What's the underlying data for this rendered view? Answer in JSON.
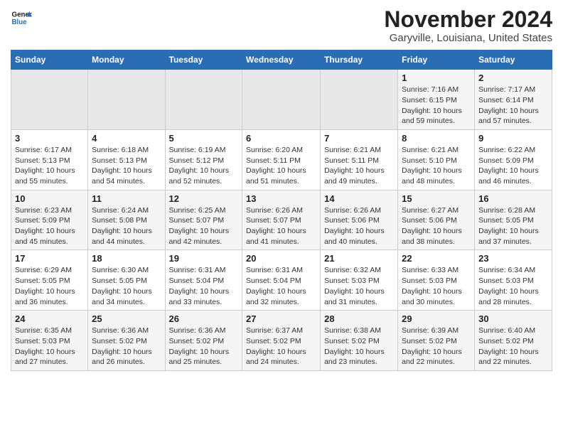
{
  "header": {
    "logo_line1": "General",
    "logo_line2": "Blue",
    "month": "November 2024",
    "location": "Garyville, Louisiana, United States"
  },
  "days_of_week": [
    "Sunday",
    "Monday",
    "Tuesday",
    "Wednesday",
    "Thursday",
    "Friday",
    "Saturday"
  ],
  "weeks": [
    [
      {
        "day": "",
        "info": ""
      },
      {
        "day": "",
        "info": ""
      },
      {
        "day": "",
        "info": ""
      },
      {
        "day": "",
        "info": ""
      },
      {
        "day": "",
        "info": ""
      },
      {
        "day": "1",
        "info": "Sunrise: 7:16 AM\nSunset: 6:15 PM\nDaylight: 10 hours and 59 minutes."
      },
      {
        "day": "2",
        "info": "Sunrise: 7:17 AM\nSunset: 6:14 PM\nDaylight: 10 hours and 57 minutes."
      }
    ],
    [
      {
        "day": "3",
        "info": "Sunrise: 6:17 AM\nSunset: 5:13 PM\nDaylight: 10 hours and 55 minutes."
      },
      {
        "day": "4",
        "info": "Sunrise: 6:18 AM\nSunset: 5:13 PM\nDaylight: 10 hours and 54 minutes."
      },
      {
        "day": "5",
        "info": "Sunrise: 6:19 AM\nSunset: 5:12 PM\nDaylight: 10 hours and 52 minutes."
      },
      {
        "day": "6",
        "info": "Sunrise: 6:20 AM\nSunset: 5:11 PM\nDaylight: 10 hours and 51 minutes."
      },
      {
        "day": "7",
        "info": "Sunrise: 6:21 AM\nSunset: 5:11 PM\nDaylight: 10 hours and 49 minutes."
      },
      {
        "day": "8",
        "info": "Sunrise: 6:21 AM\nSunset: 5:10 PM\nDaylight: 10 hours and 48 minutes."
      },
      {
        "day": "9",
        "info": "Sunrise: 6:22 AM\nSunset: 5:09 PM\nDaylight: 10 hours and 46 minutes."
      }
    ],
    [
      {
        "day": "10",
        "info": "Sunrise: 6:23 AM\nSunset: 5:09 PM\nDaylight: 10 hours and 45 minutes."
      },
      {
        "day": "11",
        "info": "Sunrise: 6:24 AM\nSunset: 5:08 PM\nDaylight: 10 hours and 44 minutes."
      },
      {
        "day": "12",
        "info": "Sunrise: 6:25 AM\nSunset: 5:07 PM\nDaylight: 10 hours and 42 minutes."
      },
      {
        "day": "13",
        "info": "Sunrise: 6:26 AM\nSunset: 5:07 PM\nDaylight: 10 hours and 41 minutes."
      },
      {
        "day": "14",
        "info": "Sunrise: 6:26 AM\nSunset: 5:06 PM\nDaylight: 10 hours and 40 minutes."
      },
      {
        "day": "15",
        "info": "Sunrise: 6:27 AM\nSunset: 5:06 PM\nDaylight: 10 hours and 38 minutes."
      },
      {
        "day": "16",
        "info": "Sunrise: 6:28 AM\nSunset: 5:05 PM\nDaylight: 10 hours and 37 minutes."
      }
    ],
    [
      {
        "day": "17",
        "info": "Sunrise: 6:29 AM\nSunset: 5:05 PM\nDaylight: 10 hours and 36 minutes."
      },
      {
        "day": "18",
        "info": "Sunrise: 6:30 AM\nSunset: 5:05 PM\nDaylight: 10 hours and 34 minutes."
      },
      {
        "day": "19",
        "info": "Sunrise: 6:31 AM\nSunset: 5:04 PM\nDaylight: 10 hours and 33 minutes."
      },
      {
        "day": "20",
        "info": "Sunrise: 6:31 AM\nSunset: 5:04 PM\nDaylight: 10 hours and 32 minutes."
      },
      {
        "day": "21",
        "info": "Sunrise: 6:32 AM\nSunset: 5:03 PM\nDaylight: 10 hours and 31 minutes."
      },
      {
        "day": "22",
        "info": "Sunrise: 6:33 AM\nSunset: 5:03 PM\nDaylight: 10 hours and 30 minutes."
      },
      {
        "day": "23",
        "info": "Sunrise: 6:34 AM\nSunset: 5:03 PM\nDaylight: 10 hours and 28 minutes."
      }
    ],
    [
      {
        "day": "24",
        "info": "Sunrise: 6:35 AM\nSunset: 5:03 PM\nDaylight: 10 hours and 27 minutes."
      },
      {
        "day": "25",
        "info": "Sunrise: 6:36 AM\nSunset: 5:02 PM\nDaylight: 10 hours and 26 minutes."
      },
      {
        "day": "26",
        "info": "Sunrise: 6:36 AM\nSunset: 5:02 PM\nDaylight: 10 hours and 25 minutes."
      },
      {
        "day": "27",
        "info": "Sunrise: 6:37 AM\nSunset: 5:02 PM\nDaylight: 10 hours and 24 minutes."
      },
      {
        "day": "28",
        "info": "Sunrise: 6:38 AM\nSunset: 5:02 PM\nDaylight: 10 hours and 23 minutes."
      },
      {
        "day": "29",
        "info": "Sunrise: 6:39 AM\nSunset: 5:02 PM\nDaylight: 10 hours and 22 minutes."
      },
      {
        "day": "30",
        "info": "Sunrise: 6:40 AM\nSunset: 5:02 PM\nDaylight: 10 hours and 22 minutes."
      }
    ]
  ]
}
